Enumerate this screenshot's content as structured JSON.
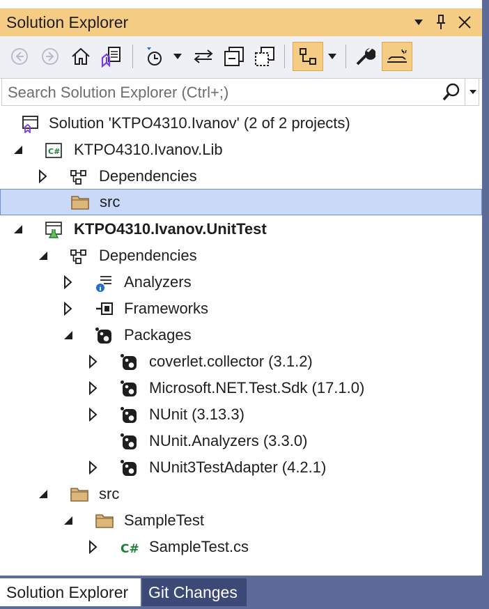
{
  "titlebar": {
    "title": "Solution Explorer",
    "dropdown_icon": "chevron-down-icon",
    "pin_icon": "pin-icon",
    "close_icon": "close-icon"
  },
  "toolbar": {
    "tools": [
      "back",
      "forward",
      "home",
      "switch-views",
      "pending-changes-filter",
      "sync-active-document",
      "collapse-all",
      "show-all-files",
      "tree-view",
      "properties",
      "preview-selected-item"
    ]
  },
  "search": {
    "placeholder": "Search Solution Explorer (Ctrl+;)"
  },
  "tree": [
    {
      "label": "Solution 'KTPO4310.Ivanov' (2 of 2 projects)",
      "icon": "solution",
      "expander": "none",
      "bold": false
    },
    {
      "label": "KTPO4310.Ivanov.Lib",
      "icon": "csharp-project",
      "expander": "expanded",
      "bold": false
    },
    {
      "label": "Dependencies",
      "icon": "dependencies",
      "expander": "collapsed",
      "bold": false
    },
    {
      "label": "src",
      "icon": "folder",
      "expander": "none",
      "bold": false,
      "selected": true
    },
    {
      "label": "KTPO4310.Ivanov.UnitTest",
      "icon": "test-project",
      "expander": "expanded",
      "bold": true
    },
    {
      "label": "Dependencies",
      "icon": "dependencies",
      "expander": "expanded",
      "bold": false
    },
    {
      "label": "Analyzers",
      "icon": "analyzers",
      "expander": "collapsed",
      "bold": false
    },
    {
      "label": "Frameworks",
      "icon": "frameworks",
      "expander": "collapsed",
      "bold": false
    },
    {
      "label": "Packages",
      "icon": "package",
      "expander": "expanded",
      "bold": false
    },
    {
      "label": "coverlet.collector (3.1.2)",
      "icon": "package",
      "expander": "collapsed",
      "bold": false
    },
    {
      "label": "Microsoft.NET.Test.Sdk (17.1.0)",
      "icon": "package",
      "expander": "collapsed",
      "bold": false
    },
    {
      "label": "NUnit (3.13.3)",
      "icon": "package",
      "expander": "collapsed",
      "bold": false
    },
    {
      "label": "NUnit.Analyzers (3.3.0)",
      "icon": "package",
      "expander": "none",
      "bold": false
    },
    {
      "label": "NUnit3TestAdapter (4.2.1)",
      "icon": "package",
      "expander": "collapsed",
      "bold": false
    },
    {
      "label": "src",
      "icon": "folder",
      "expander": "expanded",
      "bold": false
    },
    {
      "label": "SampleTest",
      "icon": "folder",
      "expander": "expanded",
      "bold": false
    },
    {
      "label": "SampleTest.cs",
      "icon": "csharp-file",
      "expander": "collapsed",
      "bold": false
    }
  ],
  "tabs": [
    {
      "label": "Solution Explorer",
      "active": true
    },
    {
      "label": "Git Changes",
      "active": false
    }
  ],
  "colors": {
    "accent": "#f5cc84",
    "frame": "#5d6b99",
    "selection": "#c9d9f7",
    "csharp_green": "#1a7f37",
    "vs_purple": "#7a3ee0",
    "folder": "#c9a265"
  }
}
